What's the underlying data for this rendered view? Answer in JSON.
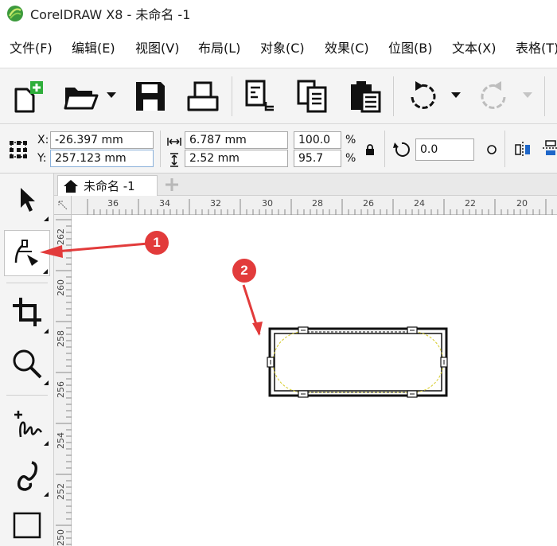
{
  "window": {
    "title": "CorelDRAW X8 - 未命名 -1"
  },
  "menu": [
    "文件(F)",
    "编辑(E)",
    "视图(V)",
    "布局(L)",
    "对象(C)",
    "效果(C)",
    "位图(B)",
    "文本(X)",
    "表格(T)"
  ],
  "toolbar": {
    "buttons": [
      "new-document",
      "open",
      "save",
      "print",
      "import",
      "export",
      "publish-pdf",
      "undo",
      "redo"
    ]
  },
  "property_bar": {
    "x_label": "X:",
    "x_value": "-26.397 mm",
    "y_label": "Y:",
    "y_value": "257.123 mm",
    "width_value": "6.787 mm",
    "height_value": "2.52 mm",
    "scale_x": "100.0",
    "scale_y": "95.7",
    "percent": "%",
    "rotation": "0.0"
  },
  "doc_tab": {
    "label": "未命名 -1"
  },
  "ruler": {
    "h_labels": [
      "36",
      "34",
      "32",
      "30",
      "28",
      "26",
      "24",
      "22",
      "20"
    ],
    "v_labels": [
      "262",
      "260",
      "258",
      "256",
      "254",
      "252",
      "250"
    ]
  },
  "callouts": {
    "first": "1",
    "second": "2"
  },
  "colors": {
    "callout": "#e23b3b",
    "accent_green": "#2fae3b"
  }
}
